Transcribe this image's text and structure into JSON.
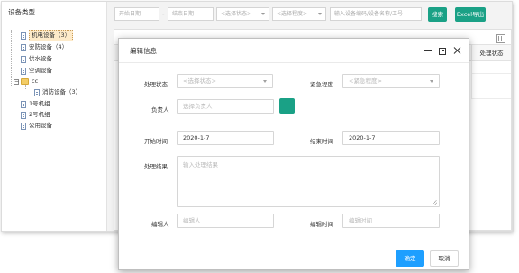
{
  "sidebar": {
    "title": "设备类型",
    "items": [
      {
        "label": "机电设备（3）",
        "selected": true,
        "icon": "file-icon"
      },
      {
        "label": "安防设备（4）",
        "selected": false,
        "icon": "file-icon"
      },
      {
        "label": "供水设备",
        "selected": false,
        "icon": "file-icon"
      },
      {
        "label": "空调设备",
        "selected": false,
        "icon": "file-icon"
      },
      {
        "label": "cc",
        "selected": false,
        "icon": "folder-icon",
        "expanded": true
      },
      {
        "label": "消防设备（3）",
        "selected": false,
        "icon": "file-icon"
      },
      {
        "label": "1号机组",
        "selected": false,
        "icon": "file-icon"
      },
      {
        "label": "2号机组",
        "selected": false,
        "icon": "file-icon"
      },
      {
        "label": "公用设备",
        "selected": false,
        "icon": "file-icon"
      }
    ],
    "toggle_symbol": "−"
  },
  "toolbar": {
    "start_date_placeholder": "开始日期",
    "date_separator": "-",
    "end_date_placeholder": "结束日期",
    "status_select_placeholder": "<选择状态>",
    "level_select_placeholder": "<选择程度>",
    "keyword_placeholder": "输入设备编码/设备名称/工号",
    "search_label": "搜索",
    "export_label": "Excel导出"
  },
  "grid": {
    "status_column_header": "处理状态"
  },
  "dialog": {
    "title": "编辑信息",
    "fields": {
      "status_label": "处理状态",
      "status_placeholder": "<选择状态>",
      "urgency_label": "紧急程度",
      "urgency_placeholder": "<紧急程度>",
      "owner_label": "负责人",
      "owner_placeholder": "选择负责人",
      "owner_pick_label": "...",
      "start_time_label": "开始时间",
      "start_time_value": "2020-1-7",
      "end_time_label": "结束时间",
      "end_time_value": "2020-1-7",
      "result_label": "处理结果",
      "result_placeholder": "输入处理结果",
      "editor_label": "编辑人",
      "editor_placeholder": "编辑人",
      "edit_time_label": "编辑时间",
      "edit_time_placeholder": "编辑时间"
    },
    "ok_label": "确定",
    "cancel_label": "取消"
  },
  "colors": {
    "accent_green": "#1aa186",
    "primary_blue": "#1e9fff",
    "selected_item_bg": "#fdeac9"
  }
}
